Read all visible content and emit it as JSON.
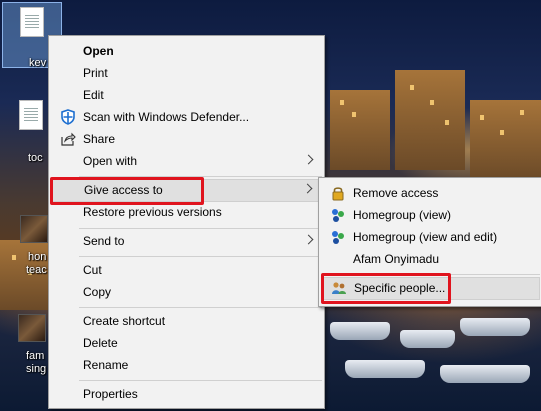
{
  "desktop": {
    "icons": [
      {
        "label": "kev",
        "kind": "document"
      },
      {
        "label": "toc",
        "kind": "document"
      },
      {
        "label": "hon",
        "label2": "teac",
        "kind": "image"
      },
      {
        "label": "fam",
        "label2": "sing",
        "kind": "image"
      }
    ]
  },
  "context_menu": {
    "items": {
      "open": "Open",
      "print": "Print",
      "edit": "Edit",
      "scan": "Scan with Windows Defender...",
      "share": "Share",
      "open_with": "Open with",
      "give_access": "Give access to",
      "restore": "Restore previous versions",
      "send_to": "Send to",
      "cut": "Cut",
      "copy": "Copy",
      "create_shortcut": "Create shortcut",
      "delete": "Delete",
      "rename": "Rename",
      "properties": "Properties"
    }
  },
  "submenu": {
    "items": {
      "remove_access": "Remove access",
      "homegroup_view": "Homegroup (view)",
      "homegroup_view_edit": "Homegroup (view and edit)",
      "user": "Afam Onyimadu",
      "specific_people": "Specific people..."
    }
  },
  "colors": {
    "menu_bg": "#f2f2f2",
    "highlight": "#e0e0e0",
    "annotation_red": "#e0141e",
    "defender_blue": "#1e6fd0"
  }
}
